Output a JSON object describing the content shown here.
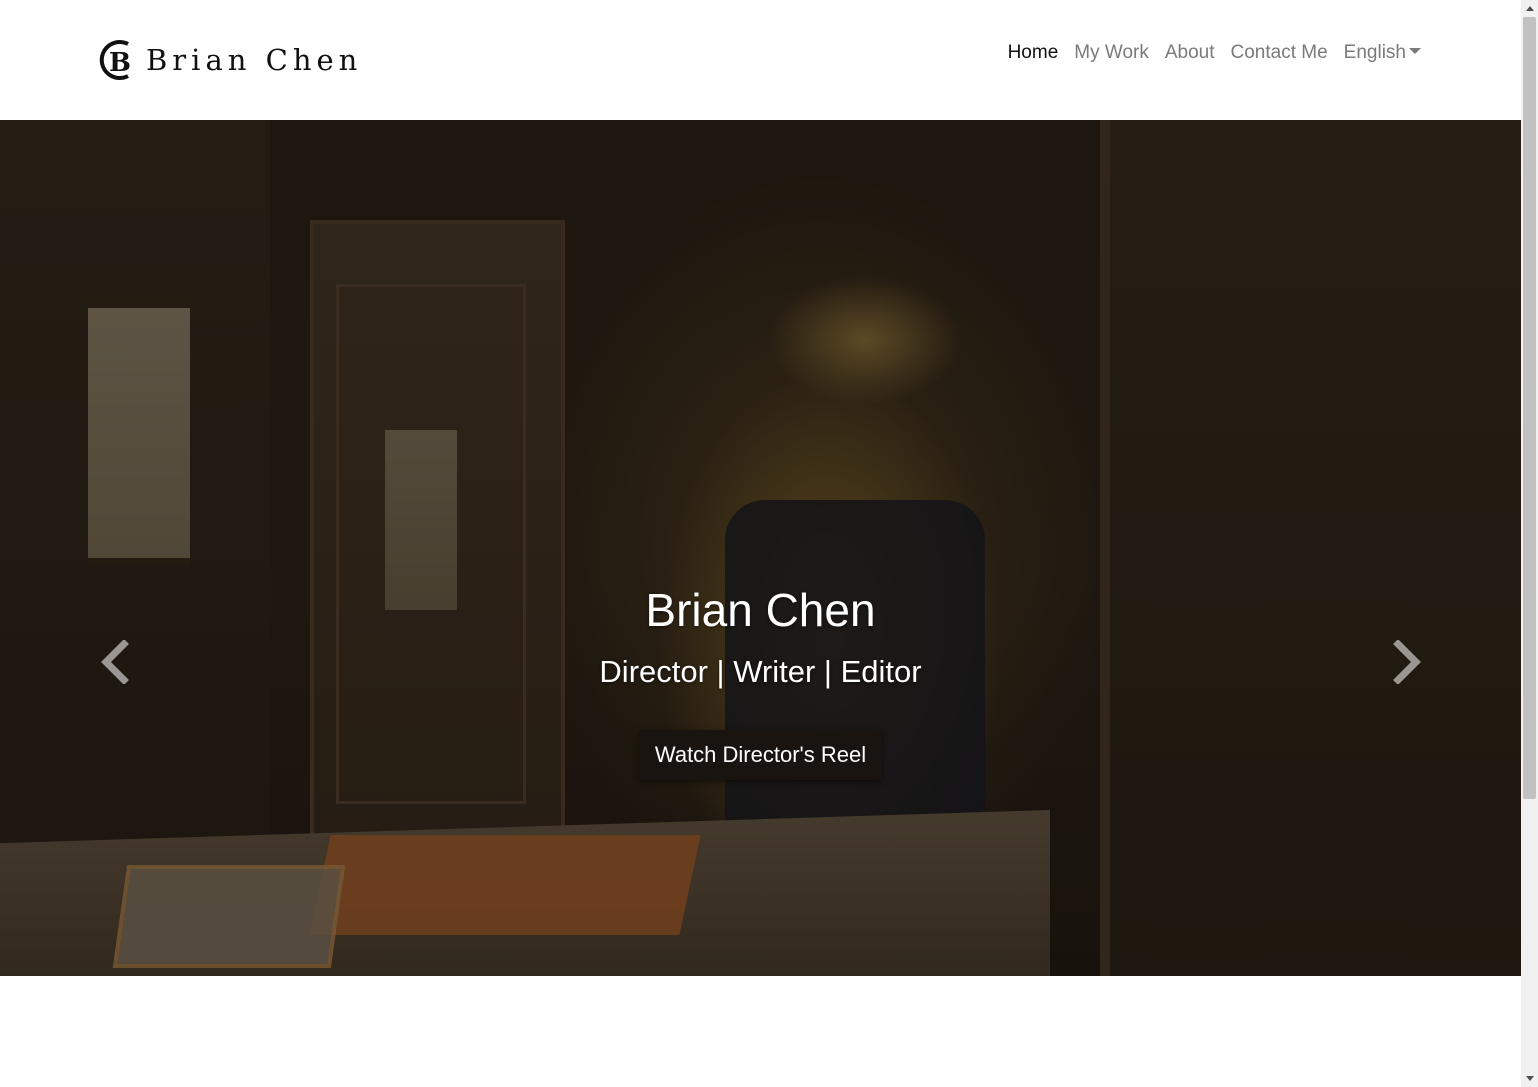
{
  "navbar": {
    "brand_text": "Brian Chen",
    "links": [
      {
        "label": "Home",
        "active": true
      },
      {
        "label": "My Work",
        "active": false
      },
      {
        "label": "About",
        "active": false
      },
      {
        "label": "Contact Me",
        "active": false
      }
    ],
    "language": {
      "label": "English"
    }
  },
  "hero": {
    "title": "Brian Chen",
    "subtitle": "Director | Writer | Editor",
    "button_label": "Watch Director's Reel",
    "prev_icon": "chevron-left-icon",
    "next_icon": "chevron-right-icon"
  },
  "colors": {
    "nav_active": "#111111",
    "nav_inactive": "#7a7a7a",
    "button_bg": "#1a1410"
  }
}
